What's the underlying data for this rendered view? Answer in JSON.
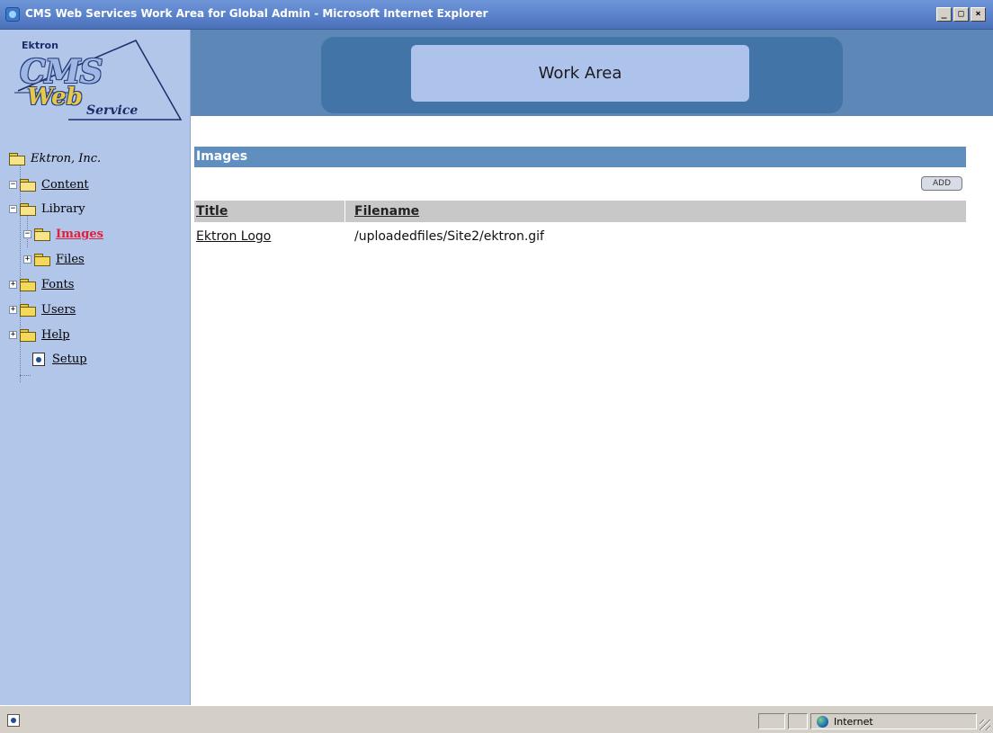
{
  "window": {
    "title": "CMS Web Services Work Area for Global Admin - Microsoft Internet Explorer",
    "buttons": {
      "minimize": "_",
      "maximize": "□",
      "close": "×"
    }
  },
  "logo": {
    "company": "Ektron",
    "line1": "CMS",
    "line2": "Web",
    "line3": "Service"
  },
  "banner": {
    "title": "Work Area"
  },
  "tree": {
    "root": "Ektron, Inc.",
    "items": [
      {
        "label": "Content"
      },
      {
        "label": "Library"
      },
      {
        "label": "Images"
      },
      {
        "label": "Files"
      },
      {
        "label": "Fonts"
      },
      {
        "label": "Users"
      },
      {
        "label": "Help"
      },
      {
        "label": "Setup"
      }
    ]
  },
  "content": {
    "section_title": "Images",
    "add_label": "ADD",
    "columns": [
      "Title",
      "Filename"
    ],
    "rows": [
      {
        "title": "Ektron Logo",
        "filename": "/uploadedfiles/Site2/ektron.gif"
      }
    ]
  },
  "status": {
    "zone": "Internet"
  }
}
